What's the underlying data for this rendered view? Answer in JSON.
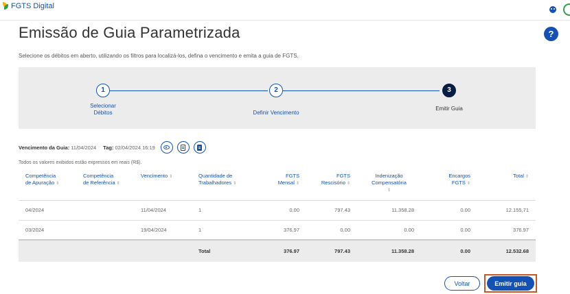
{
  "header": {
    "brand_name": "FGTS Digital",
    "logo_icon": "fgts-leaf-logo-icon",
    "user_icon": "user-menu-icon",
    "avatar_icon": "avatar-icon"
  },
  "page": {
    "title": "Emissão de Guia Parametrizada",
    "help_label": "?",
    "subtitle": "Selecione os débitos em aberto, utilizando os filtros para localizá-los, defina o vencimento e emita a guia de FGTS."
  },
  "stepper": {
    "steps": [
      {
        "number": "1",
        "label_line1": "Selecionar",
        "label_line2": "Débitos",
        "state": "done"
      },
      {
        "number": "2",
        "label_line1": "Definir Vencimento",
        "label_line2": "",
        "state": "done"
      },
      {
        "number": "3",
        "label_line1": "Emitir Guia",
        "label_line2": "",
        "state": "active"
      }
    ]
  },
  "guia": {
    "vencimento_label": "Vencimento da Guia:",
    "vencimento_value": "11/04/2024",
    "tag_label": "Tag:",
    "tag_value": "02/04/2024 16:19",
    "actions": [
      "eye-icon",
      "document-icon",
      "download-document-icon"
    ]
  },
  "note": "Todos os valores exibidos estão expressos em reais (R$).",
  "table": {
    "sort_glyph": "⇕",
    "headers": [
      {
        "line1": "Competência",
        "line2": "de Apuração",
        "sort": true
      },
      {
        "line1": "Competência",
        "line2": "de Referência",
        "sort": true
      },
      {
        "line1": "Vencimento",
        "line2": "",
        "sort": true
      },
      {
        "line1": "Quantidade de",
        "line2": "Trabalhadores",
        "sort": true
      },
      {
        "line1": "FGTS",
        "line2": "Mensal",
        "sort": true
      },
      {
        "line1": "FGTS",
        "line2": "Rescisório",
        "sort": true
      },
      {
        "line1": "Indenização",
        "line2": "Compensatória",
        "sort": true
      },
      {
        "line1": "Encargos",
        "line2": "FGTS",
        "sort": true
      },
      {
        "line1": "Total",
        "line2": "",
        "sort": true
      }
    ],
    "rows": [
      {
        "apuracao": "04/2024",
        "referencia": "",
        "vencimento": "11/04/2024",
        "trabalhadores": "1",
        "fgts_mensal": "0.00",
        "fgts_rescisorio": "797.43",
        "indenizacao": "11.358.28",
        "encargos": "0.00",
        "total": "12.155,71"
      },
      {
        "apuracao": "03/2024",
        "referencia": "",
        "vencimento": "19/04/2024",
        "trabalhadores": "1",
        "fgts_mensal": "376.97",
        "fgts_rescisorio": "0.00",
        "indenizacao": "0.00",
        "encargos": "0.00",
        "total": "376.97"
      }
    ],
    "total_row": {
      "label": "Total",
      "fgts_mensal": "376.97",
      "fgts_rescisorio": "797.43",
      "indenizacao": "11.358.28",
      "encargos": "0.00",
      "total": "12.532.68"
    }
  },
  "buttons": {
    "voltar": "Voltar",
    "emitir": "Emitir guia"
  },
  "colors": {
    "primary": "#1351b4",
    "active_step": "#071d41",
    "stepper_bg": "#ececec",
    "focus_outline": "#c8542c"
  }
}
